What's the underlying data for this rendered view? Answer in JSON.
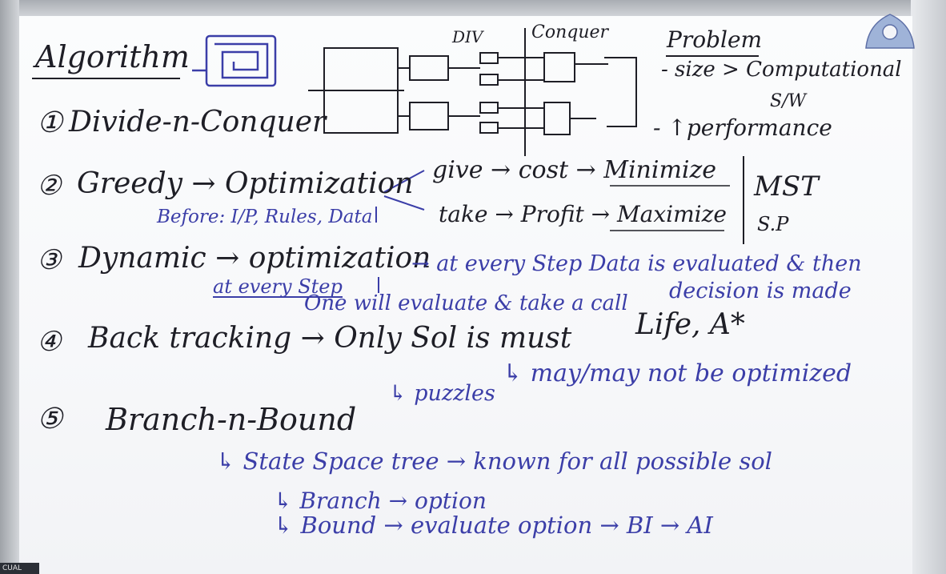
{
  "board": {
    "title": "Algorithm",
    "dac": {
      "number": "①",
      "label": "Divide-n-Conquer",
      "div_label": "DIV",
      "conquer_label": "Conquer"
    },
    "problem": {
      "heading": "Problem",
      "size_line": "- size > Computational",
      "sw": "S/W",
      "perf_line": "- ↑performance"
    },
    "greedy": {
      "number": "②",
      "label": "Greedy → Optimization",
      "give_line": "give → cost → Minimize",
      "take_line": "take → Profit → Maximize",
      "before": "Before: I/P, Rules, Data",
      "mst": "MST",
      "sp": "S.P"
    },
    "dynamic": {
      "number": "③",
      "label": "Dynamic → optimization",
      "step_line": "→ at every Step Data is evaluated & then",
      "decision": "decision is made",
      "at_every": "at every Step",
      "one_will": "One will evaluate & take a call"
    },
    "backtracking": {
      "number": "④",
      "label": "Back tracking → Only Sol is must",
      "puzzles": "↳ puzzles",
      "may": "↳ may/may not be optimized",
      "life": "Life, A*"
    },
    "bnb": {
      "number": "⑤",
      "label": "Branch-n-Bound",
      "state_space": "↳ State Space tree → known for all possible sol",
      "branch": "↳ Branch → option",
      "bound": "↳ Bound → evaluate option → BI → AI"
    }
  },
  "corner_label": "CUAL",
  "colors": {
    "black_marker": "#1e1e26",
    "blue_marker": "#3b3ea8",
    "board": "#f8f9fb"
  }
}
